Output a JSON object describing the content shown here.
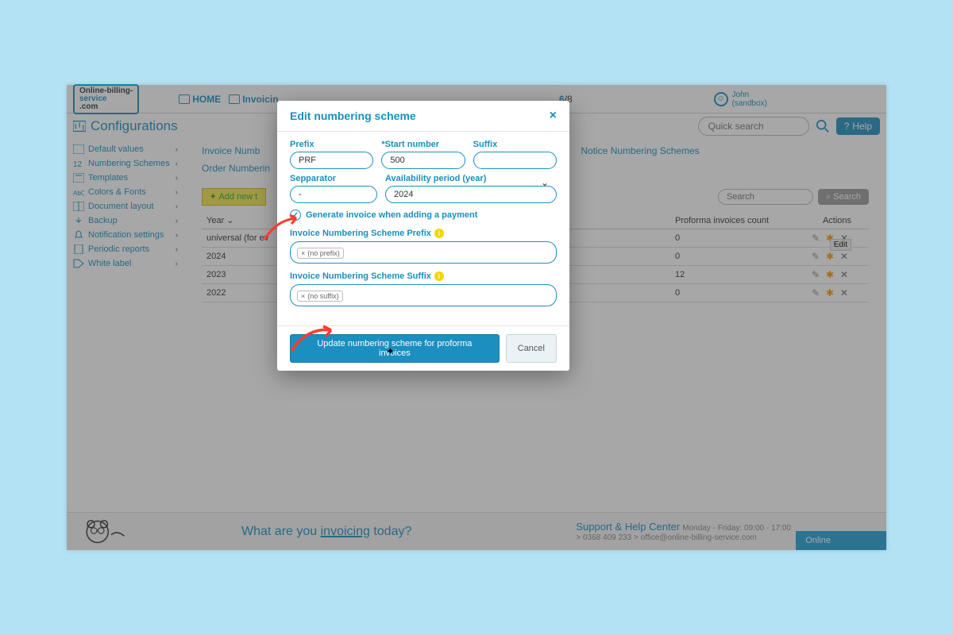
{
  "logo": {
    "l1": "Online-billing-",
    "l2": "service",
    "l3": ".com"
  },
  "nav": {
    "home": "HOME",
    "invoicing": "Invoicin"
  },
  "steps": {
    "cur": "6",
    "total": "8"
  },
  "user": {
    "name": "John",
    "env": "(sandbox)"
  },
  "page": {
    "title": "Configurations"
  },
  "search": {
    "quick": "Quick search",
    "help": "Help"
  },
  "sidebar": {
    "items": [
      {
        "label": "Default values"
      },
      {
        "label": "Numbering Schemes"
      },
      {
        "label": "Templates"
      },
      {
        "label": "Colors & Fonts"
      },
      {
        "label": "Document layout"
      },
      {
        "label": "Backup"
      },
      {
        "label": "Notification settings"
      },
      {
        "label": "Periodic reports"
      },
      {
        "label": "White label"
      }
    ]
  },
  "tabs1": {
    "a": "Invoice Numb",
    "b": "Notice Numbering Schemes"
  },
  "tabs2": {
    "a": "Order Numberin"
  },
  "toolbar": {
    "add": "Add new t",
    "searchPH": "Search",
    "searchBtn": "Search"
  },
  "table": {
    "h1": "Year",
    "h2": "Proforma invoices count",
    "h3": "Actions",
    "rows": [
      {
        "year": "universal (for ev",
        "count": "0"
      },
      {
        "year": "2024",
        "count": "0"
      },
      {
        "year": "2023",
        "count": "12"
      },
      {
        "year": "2022",
        "count": "0"
      }
    ]
  },
  "tooltip": "Edit",
  "modal": {
    "title": "Edit numbering scheme",
    "prefixL": "Prefix",
    "prefixV": "PRF",
    "startL": "*Start number",
    "startV": "500",
    "suffixL": "Suffix",
    "suffixV": "",
    "sepL": "Sepparator",
    "sepV": "-",
    "availL": "Availability period (year)",
    "availV": "2024",
    "chk": "Generate invoice when adding a payment",
    "invPrefL": "Invoice Numbering Scheme Prefix",
    "invPrefTag": "(no prefix)",
    "invSufL": "Invoice Numbering Scheme Suffix",
    "invSufTag": "(no suffix)",
    "update": "Update numbering scheme for proforma invoices",
    "cancel": "Cancel"
  },
  "footer": {
    "tagline1": "What are you ",
    "tagline2": "invoicing",
    "tagline3": " today?",
    "support": "Support & Help Center",
    "hours": "Monday - Friday: 09:00 - 17:00",
    "contact": "> 0368 409 233  >  office@online-billing-service.com",
    "online": "Online"
  }
}
